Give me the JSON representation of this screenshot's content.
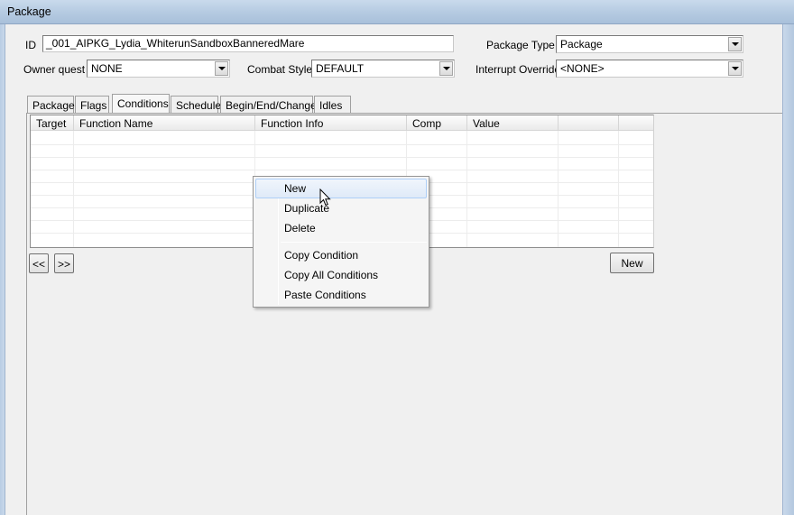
{
  "window": {
    "title": "Package"
  },
  "fields": {
    "id_label": "ID",
    "id_value": "_001_AIPKG_Lydia_WhiterunSandboxBanneredMare",
    "package_type_label": "Package Type",
    "package_type_value": "Package",
    "owner_quest_label": "Owner quest",
    "owner_quest_value": "NONE",
    "combat_style_label": "Combat Style",
    "combat_style_value": "DEFAULT",
    "interrupt_override_label": "Interrupt Override",
    "interrupt_override_value": "<NONE>"
  },
  "tabs": [
    {
      "label": "Package"
    },
    {
      "label": "Flags"
    },
    {
      "label": "Conditions"
    },
    {
      "label": "Schedule"
    },
    {
      "label": "Begin/End/Change"
    },
    {
      "label": "Idles"
    }
  ],
  "active_tab": "Conditions",
  "conditions_table": {
    "columns": [
      "Target",
      "Function Name",
      "Function Info",
      "Comp",
      "Value",
      ""
    ],
    "rows": []
  },
  "buttons": {
    "prev_label": "<<",
    "next_label": ">>",
    "new_label": "New"
  },
  "context_menu": {
    "items": [
      "New",
      "Duplicate",
      "Delete",
      "Copy Condition",
      "Copy All Conditions",
      "Paste Conditions"
    ],
    "hovered": "New"
  }
}
